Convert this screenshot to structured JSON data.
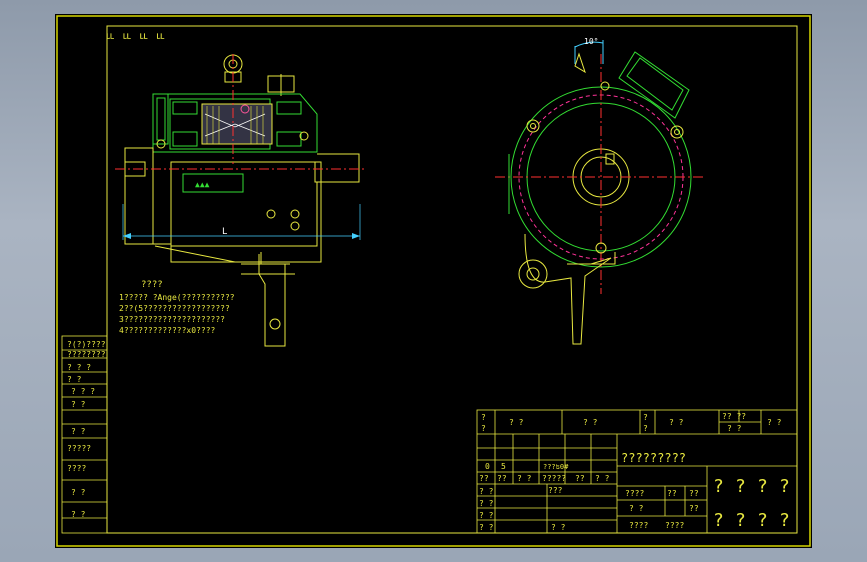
{
  "drawing": {
    "corner_marks": "ㅥ ㅥ ㅥ ㅥ",
    "dim_length": "L",
    "dim_angle": "10°",
    "notes_title": "????",
    "notes": [
      "1?????      ?Ange(???????????",
      "2??(5??????????????????",
      "3?????????????????????",
      "4?????????????x0????"
    ]
  },
  "left_strip": {
    "rows": [
      "?(?)????",
      "????????",
      "? ? ?",
      "?   ?",
      "? ? ?",
      "?   ?",
      "?   ?",
      "?????",
      "????",
      "?   ?",
      "?   ?"
    ]
  },
  "title_block": {
    "header": [
      "?",
      "?  ?",
      "?   ?",
      "?",
      "?   ?",
      "?? ??",
      "?  ?"
    ],
    "header_sub": [
      "?",
      "?",
      "? ?"
    ],
    "drawing_name": "?????????",
    "row_a": [
      "0",
      "5",
      "???ʦ0#"
    ],
    "row_b": [
      "??",
      "??",
      "? ?",
      "?????",
      "??",
      "? ?"
    ],
    "small_labels": [
      "? ?",
      "? ?",
      "? ?",
      "? ?",
      "? ?"
    ],
    "mid_text": "???",
    "bottom_text": "? ?",
    "scale_labels": [
      "????",
      "??",
      "??",
      "??",
      "????",
      "????"
    ],
    "big_marks": [
      "?",
      "?",
      "?",
      "?"
    ]
  }
}
